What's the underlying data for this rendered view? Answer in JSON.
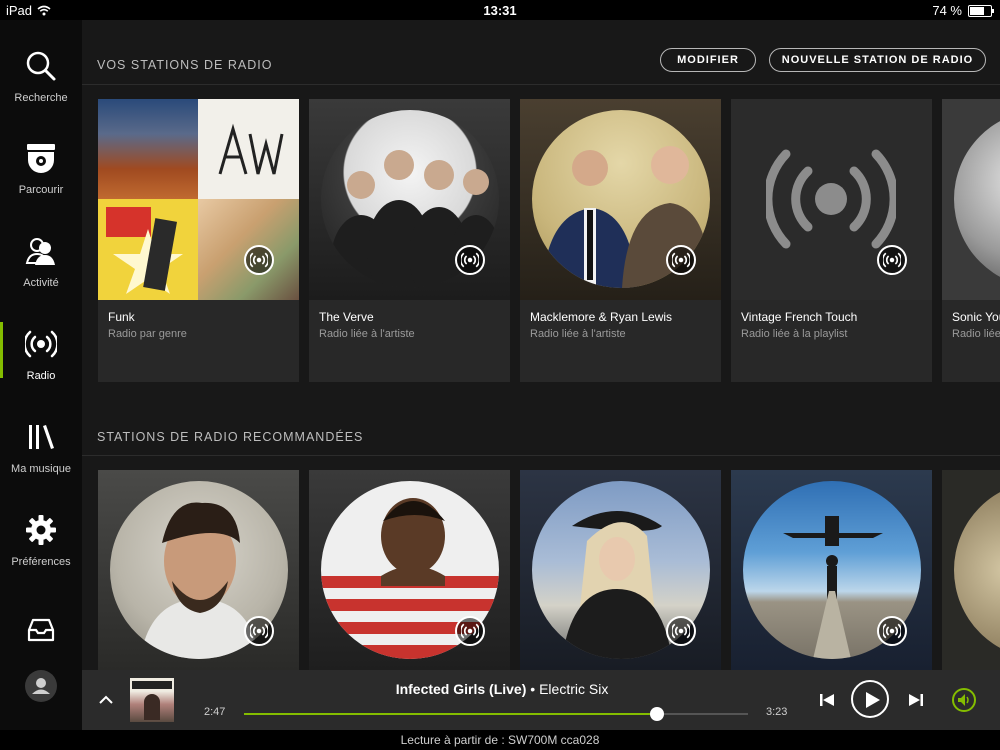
{
  "status": {
    "device": "iPad",
    "time": "13:31",
    "battery": "74 %",
    "battery_level": 0.74
  },
  "sidebar": {
    "items": [
      {
        "id": "recherche",
        "label": "Recherche",
        "icon": "search-icon"
      },
      {
        "id": "parcourir",
        "label": "Parcourir",
        "icon": "browse-icon"
      },
      {
        "id": "activite",
        "label": "Activité",
        "icon": "activity-icon"
      },
      {
        "id": "radio",
        "label": "Radio",
        "icon": "radio-icon",
        "active": true
      },
      {
        "id": "ma-musique",
        "label": "Ma musique",
        "icon": "library-icon"
      },
      {
        "id": "preferences",
        "label": "Préférences",
        "icon": "gear-icon"
      }
    ],
    "inbox_icon": "inbox-icon",
    "avatar_icon": "user-icon"
  },
  "your_stations": {
    "title": "VOS STATIONS DE RADIO",
    "edit_label": "MODIFIER",
    "new_label": "NOUVELLE STATION DE RADIO",
    "cards": [
      {
        "title": "Funk",
        "subtitle": "Radio par genre"
      },
      {
        "title": "The Verve",
        "subtitle": "Radio liée à l'artiste"
      },
      {
        "title": "Macklemore & Ryan Lewis",
        "subtitle": "Radio liée à l'artiste"
      },
      {
        "title": "Vintage French Touch",
        "subtitle": "Radio liée à la playlist"
      },
      {
        "title": "Sonic You",
        "subtitle": "Radio liée"
      }
    ]
  },
  "recommended": {
    "title": "STATIONS DE RADIO RECOMMANDÉES"
  },
  "player": {
    "track": "Infected Girls (Live)",
    "separator": "•",
    "artist": "Electric Six",
    "elapsed": "2:47",
    "total": "3:23",
    "progress": 0.82,
    "footer": "Lecture à partir de : SW700M cca028"
  },
  "colors": {
    "accent": "#84bd00",
    "background": "#181818",
    "card": "#282828"
  }
}
